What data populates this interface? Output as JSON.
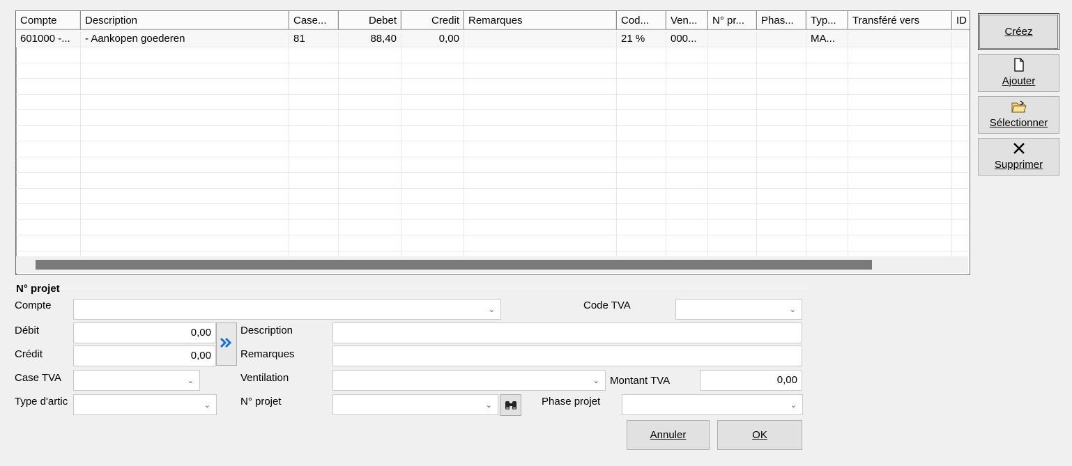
{
  "grid": {
    "columns": [
      {
        "label": "Compte"
      },
      {
        "label": "Description"
      },
      {
        "label": "Case..."
      },
      {
        "label": "Debet"
      },
      {
        "label": "Credit"
      },
      {
        "label": "Remarques"
      },
      {
        "label": "Cod..."
      },
      {
        "label": "Ven..."
      },
      {
        "label": "N° pr..."
      },
      {
        "label": "Phas..."
      },
      {
        "label": "Typ..."
      },
      {
        "label": "Transféré vers"
      },
      {
        "label": "ID"
      }
    ],
    "rows": [
      {
        "compte": "601000 -...",
        "description": "- Aankopen goederen",
        "case": "81",
        "debet": "88,40",
        "credit": "0,00",
        "remarques": "",
        "code": "21 %",
        "ventilation": "000...",
        "projet": "",
        "phase": "",
        "type": "MA...",
        "transfere": "",
        "id": ""
      }
    ]
  },
  "buttons": {
    "creez": {
      "label": "Créez"
    },
    "ajouter": {
      "label": "Ajouter",
      "icon": "document-icon"
    },
    "selectionner": {
      "label": "Sélectionner",
      "icon": "folder-open-icon"
    },
    "supprimer": {
      "label": "Supprimer",
      "icon": "delete-x-icon"
    },
    "annuler": {
      "label": "Annuler"
    },
    "ok": {
      "label": "OK"
    }
  },
  "form": {
    "group_title": "N° projet",
    "compte": {
      "label": "Compte",
      "value": ""
    },
    "code_tva": {
      "label": "Code TVA",
      "value": ""
    },
    "debit": {
      "label": "Débit",
      "value": "0,00"
    },
    "credit": {
      "label": "Crédit",
      "value": "0,00"
    },
    "description": {
      "label": "Description",
      "value": ""
    },
    "remarques": {
      "label": "Remarques",
      "value": ""
    },
    "case_tva": {
      "label": "Case TVA",
      "value": ""
    },
    "ventilation": {
      "label": "Ventilation",
      "value": ""
    },
    "montant_tva": {
      "label": "Montant TVA",
      "value": "0,00"
    },
    "type_article": {
      "label": "Type d'artic",
      "value": ""
    },
    "n_projet": {
      "label": "N° projet",
      "value": ""
    },
    "phase_projet": {
      "label": "Phase projet",
      "value": ""
    }
  },
  "colors": {
    "transfer_arrow": "#1c6fd1",
    "scrollbar_thumb": "#7a7a7a"
  }
}
